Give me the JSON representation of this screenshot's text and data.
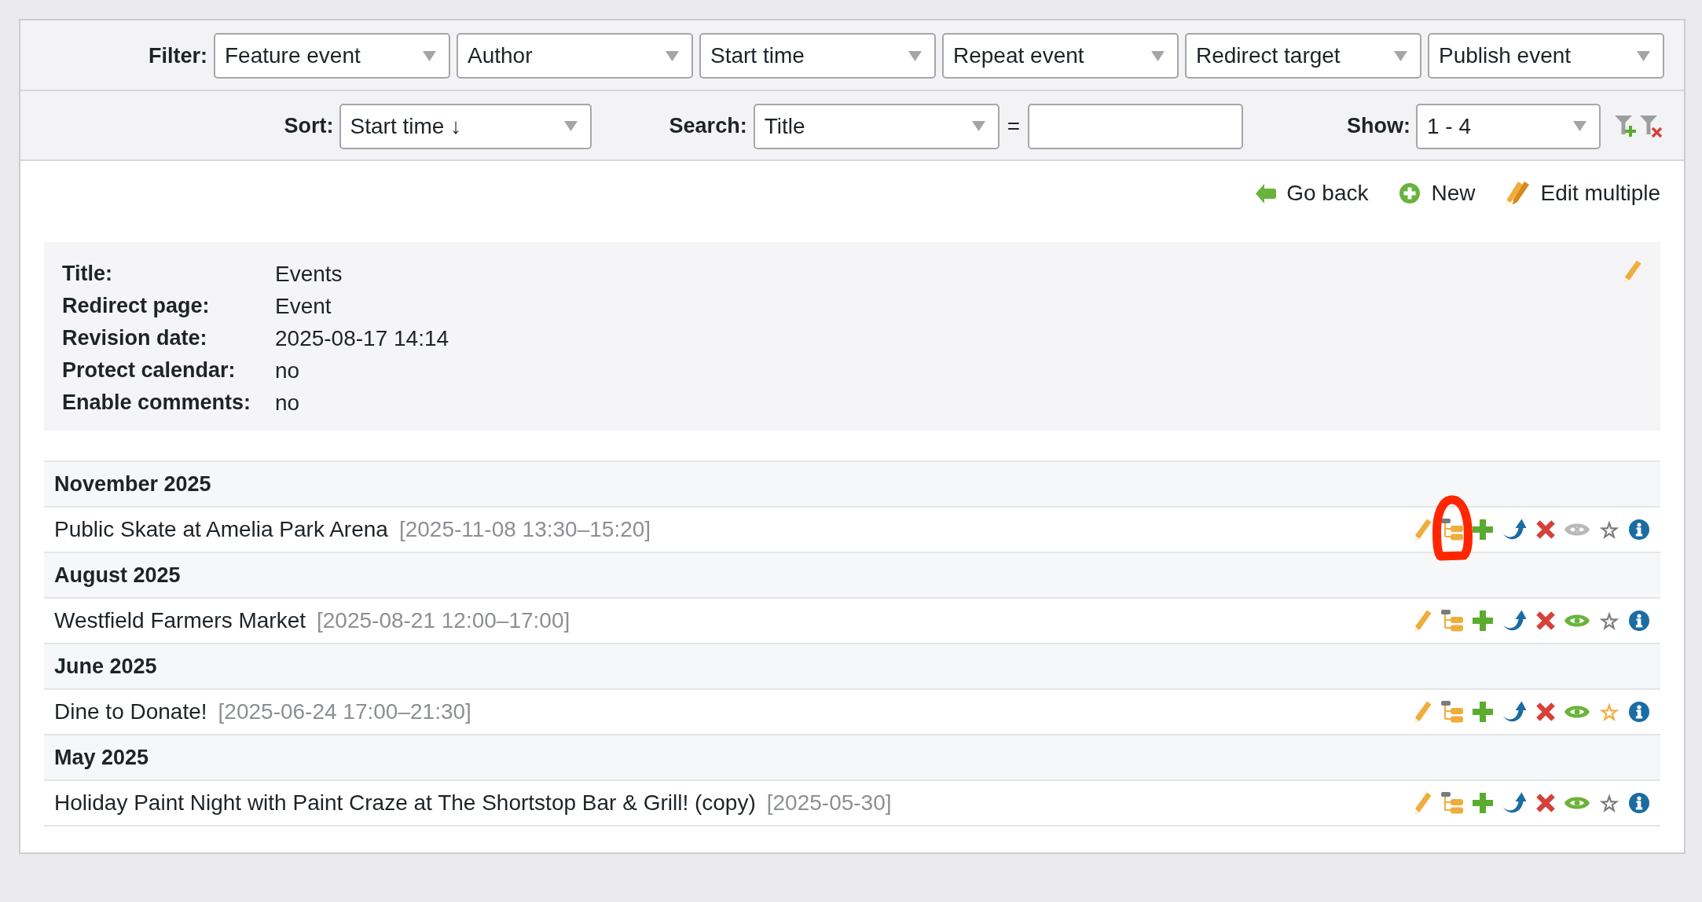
{
  "filter_bar": {
    "label": "Filter:",
    "dropdowns": [
      "Feature event",
      "Author",
      "Start time",
      "Repeat event",
      "Redirect target",
      "Publish event"
    ]
  },
  "sort_bar": {
    "sort_label": "Sort:",
    "sort_value": "Start time ↓",
    "search_label": "Search:",
    "search_field": "Title",
    "operator": "=",
    "show_label": "Show:",
    "show_value": "1 - 4"
  },
  "actions": [
    {
      "kind": "back",
      "label": "Go back"
    },
    {
      "kind": "new",
      "label": "New"
    },
    {
      "kind": "edit_multiple",
      "label": "Edit multiple"
    }
  ],
  "details": [
    {
      "label": "Title:",
      "value": "Events"
    },
    {
      "label": "Redirect page:",
      "value": "Event"
    },
    {
      "label": "Revision date:",
      "value": "2025-08-17 14:14"
    },
    {
      "label": "Protect calendar:",
      "value": "no"
    },
    {
      "label": "Enable comments:",
      "value": "no"
    }
  ],
  "groups": [
    {
      "month": "November 2025",
      "events": [
        {
          "title": "Public Skate at Amelia Park Arena",
          "date": "[2025-11-08 13:30–15:20]",
          "published": false,
          "featured": false,
          "circled": true
        }
      ]
    },
    {
      "month": "August 2025",
      "events": [
        {
          "title": "Westfield Farmers Market",
          "date": "[2025-08-21 12:00–17:00]",
          "published": true,
          "featured": false,
          "circled": false
        }
      ]
    },
    {
      "month": "June 2025",
      "events": [
        {
          "title": "Dine to Donate!",
          "date": "[2025-06-24 17:00–21:30]",
          "published": true,
          "featured": true,
          "circled": false
        }
      ]
    },
    {
      "month": "May 2025",
      "events": [
        {
          "title": "Holiday Paint Night with Paint Craze at The Shortstop Bar & Grill! (copy)",
          "date": "[2025-05-30]",
          "published": true,
          "featured": false,
          "circled": false
        }
      ]
    }
  ]
}
